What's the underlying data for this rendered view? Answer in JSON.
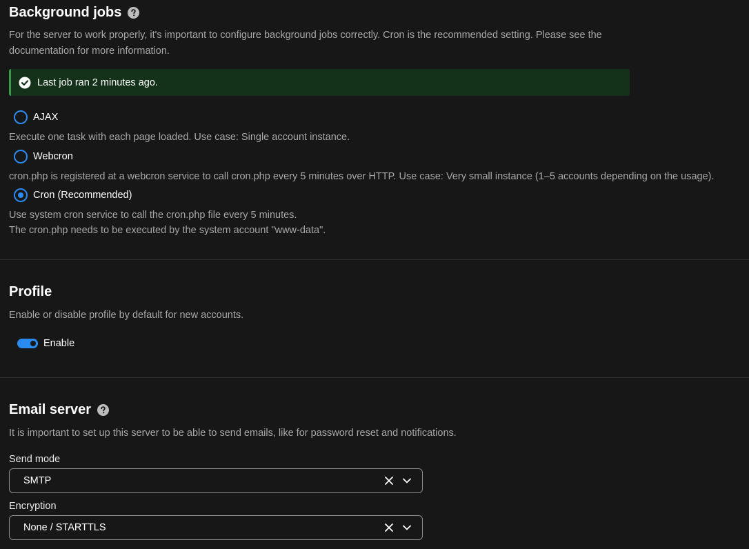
{
  "background_jobs": {
    "title": "Background jobs",
    "help_icon": "help-circle-icon",
    "description_line1": "For the server to work properly, it's important to configure background jobs correctly. Cron is the recommended setting. Please see the",
    "description_line2": "documentation for more information.",
    "notice": {
      "icon": "check-circle-icon",
      "text": "Last job ran 2 minutes ago.",
      "background": "#143219",
      "accent": "#3b9a4e"
    },
    "options": [
      {
        "label": "AJAX",
        "selected": false,
        "description": "Execute one task with each page loaded. Use case: Single account instance."
      },
      {
        "label": "Webcron",
        "selected": false,
        "description": "cron.php is registered at a webcron service to call cron.php every 5 minutes over HTTP. Use case: Very small instance (1–5 accounts depending on the usage)."
      },
      {
        "label": "Cron (Recommended)",
        "selected": true,
        "description_line1": "Use system cron service to call the cron.php file every 5 minutes.",
        "description_line2": "The cron.php needs to be executed by the system account \"www-data\"."
      }
    ]
  },
  "profile": {
    "title": "Profile",
    "description": "Enable or disable profile by default for new accounts.",
    "toggle_label": "Enable",
    "toggle_on": true
  },
  "email_server": {
    "title": "Email server",
    "help_icon": "help-circle-icon",
    "description": "It is important to set up this server to be able to send emails, like for password reset and notifications.",
    "send_mode_label": "Send mode",
    "send_mode_value": "SMTP",
    "encryption_label": "Encryption",
    "encryption_value": "None / STARTTLS"
  },
  "colors": {
    "accent": "#2a8cf0",
    "background": "#171717",
    "text": "#ebebeb",
    "muted_text": "#a8a8a8"
  }
}
